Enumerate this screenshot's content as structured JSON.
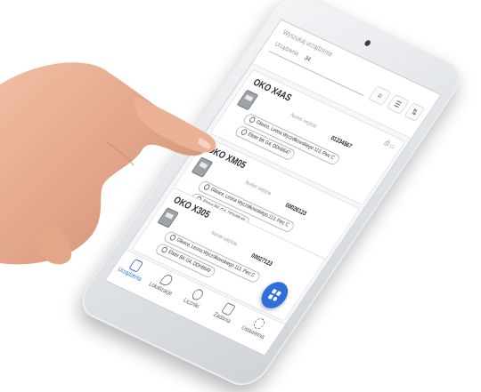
{
  "app": {
    "search_placeholder": "Wyszukaj urządzenia",
    "filter_label": "Urządzenia",
    "filter_value": "34"
  },
  "devices": [
    {
      "title": "OKO X4AS",
      "number_label": "Numer wejścia",
      "number_value": "01234567",
      "address": "Gliwice, Leona Wyczółkowskiego 113, Piec C",
      "sublocation": "Elster BK G4, DDH8647"
    },
    {
      "title": "OKO XM05",
      "number_label": "Numer wejścia",
      "number_value": "00026123",
      "address": "Gliwice, Leona Wyczółkowskiego 113, Piec C",
      "sublocation": "Elster BK G4, DDH8648"
    },
    {
      "title": "OKO X305",
      "number_label": "Numer wejścia",
      "number_value": "00027123",
      "address": "Gliwice, Leona Wyczółkowskiego 113, Piec C",
      "sublocation": "Elster BK G4, DDH8649"
    }
  ],
  "nav": [
    {
      "label": "Urządzenia",
      "icon": "devices-icon",
      "active": true
    },
    {
      "label": "Lokalizacje",
      "icon": "location-pin-icon",
      "active": false
    },
    {
      "label": "Liczniki",
      "icon": "meter-icon",
      "active": false
    },
    {
      "label": "Zadania",
      "icon": "tasks-icon",
      "active": false
    },
    {
      "label": "Ustawienia",
      "icon": "settings-gear-icon",
      "active": false
    }
  ],
  "colors": {
    "accent": "#2f6fdc",
    "skin": "#e8a98d"
  }
}
